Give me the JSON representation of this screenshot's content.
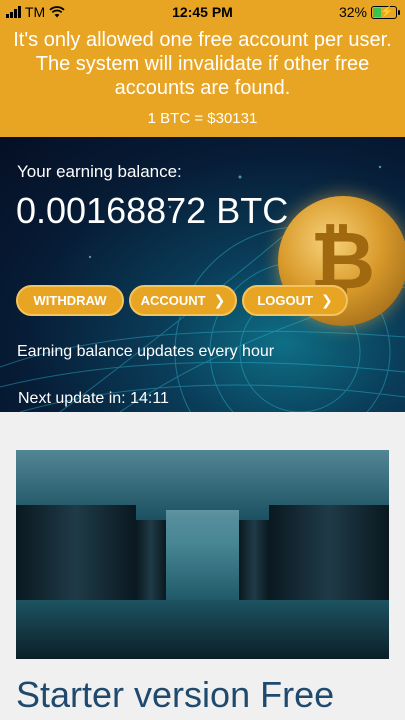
{
  "status_bar": {
    "carrier": "TM",
    "time": "12:45 PM",
    "battery": "32%"
  },
  "notice": {
    "message": "It's only allowed one free account per user. The system will invalidate if other free accounts are found.",
    "rate": "1 BTC = $30131"
  },
  "balance": {
    "label": "Your earning balance:",
    "value": "0.00168872 BTC"
  },
  "buttons": {
    "withdraw": "WITHDRAW",
    "account": "ACCOUNT",
    "logout": "LOGOUT"
  },
  "info": {
    "updates": "Earning balance updates every hour",
    "next_update": "Next update in: 14:11"
  },
  "card": {
    "title": "Starter version Free"
  },
  "colors": {
    "accent": "#e8a524",
    "title": "#1f4a6d"
  },
  "icons": {
    "signal": "cellular-signal-icon",
    "wifi": "wifi-icon",
    "battery": "battery-charging-icon",
    "chevron": "chevron-right-icon"
  }
}
